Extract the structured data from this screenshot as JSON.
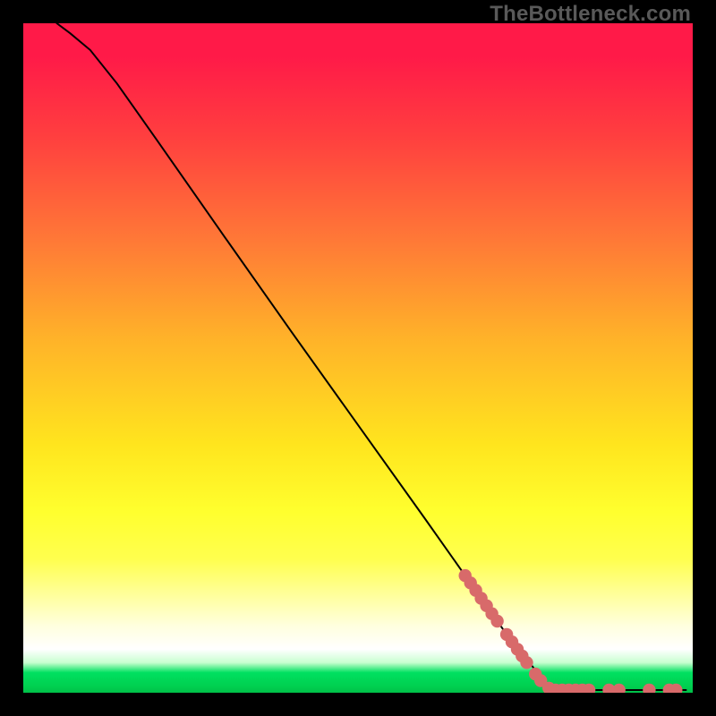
{
  "watermark": "TheBottleneck.com",
  "colors": {
    "point": "#d86a6a",
    "curve": "#000000"
  },
  "chart_data": {
    "type": "line",
    "title": "",
    "xlabel": "",
    "ylabel": "",
    "xlim": [
      0,
      100
    ],
    "ylim": [
      0,
      100
    ],
    "curve": [
      {
        "x": 5,
        "y": 100
      },
      {
        "x": 7,
        "y": 98.5
      },
      {
        "x": 10,
        "y": 96
      },
      {
        "x": 14,
        "y": 91
      },
      {
        "x": 20,
        "y": 82.5
      },
      {
        "x": 30,
        "y": 68.2
      },
      {
        "x": 40,
        "y": 54
      },
      {
        "x": 50,
        "y": 40
      },
      {
        "x": 60,
        "y": 26
      },
      {
        "x": 66,
        "y": 17.5
      },
      {
        "x": 72,
        "y": 9
      },
      {
        "x": 78,
        "y": 1.5
      },
      {
        "x": 79,
        "y": 0.7
      },
      {
        "x": 80,
        "y": 0.4
      },
      {
        "x": 85,
        "y": 0.4
      },
      {
        "x": 90,
        "y": 0.4
      },
      {
        "x": 95,
        "y": 0.4
      },
      {
        "x": 99,
        "y": 0.4
      }
    ],
    "points": [
      {
        "x": 66.0,
        "y": 17.5
      },
      {
        "x": 66.8,
        "y": 16.4
      },
      {
        "x": 67.6,
        "y": 15.3
      },
      {
        "x": 68.4,
        "y": 14.1
      },
      {
        "x": 69.2,
        "y": 13.0
      },
      {
        "x": 70.0,
        "y": 11.8
      },
      {
        "x": 70.8,
        "y": 10.7
      },
      {
        "x": 72.2,
        "y": 8.7
      },
      {
        "x": 73.0,
        "y": 7.6
      },
      {
        "x": 73.8,
        "y": 6.5
      },
      {
        "x": 74.5,
        "y": 5.5
      },
      {
        "x": 75.2,
        "y": 4.5
      },
      {
        "x": 76.5,
        "y": 2.8
      },
      {
        "x": 77.3,
        "y": 1.8
      },
      {
        "x": 78.5,
        "y": 0.7
      },
      {
        "x": 79.5,
        "y": 0.4
      },
      {
        "x": 80.5,
        "y": 0.4
      },
      {
        "x": 81.5,
        "y": 0.4
      },
      {
        "x": 82.5,
        "y": 0.4
      },
      {
        "x": 83.5,
        "y": 0.4
      },
      {
        "x": 84.5,
        "y": 0.4
      },
      {
        "x": 87.5,
        "y": 0.4
      },
      {
        "x": 89.0,
        "y": 0.4
      },
      {
        "x": 93.5,
        "y": 0.4
      },
      {
        "x": 96.5,
        "y": 0.4
      },
      {
        "x": 97.5,
        "y": 0.4
      }
    ]
  }
}
